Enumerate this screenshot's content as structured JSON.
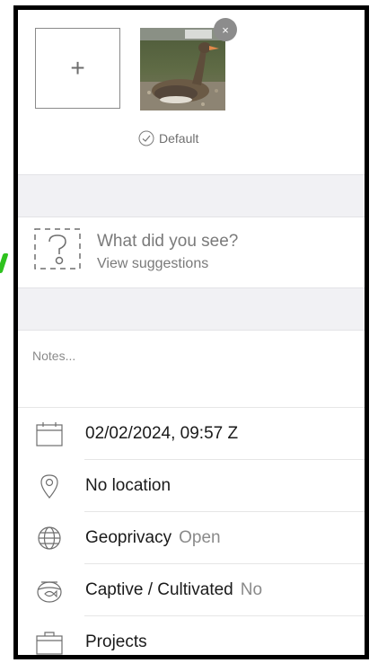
{
  "photos": {
    "add_label": "+",
    "remove_label": "×",
    "default_label": "Default"
  },
  "species": {
    "title": "What did you see?",
    "subtitle": "View suggestions"
  },
  "notes": {
    "placeholder": "Notes..."
  },
  "details": {
    "date": "02/02/2024, 09:57 Z",
    "location": "No location",
    "geoprivacy_label": "Geoprivacy",
    "geoprivacy_value": "Open",
    "captive_label": "Captive / Cultivated",
    "captive_value": "No",
    "projects_label": "Projects"
  },
  "colors": {
    "accent_green": "#2ec21e",
    "section_band": "#f1f1f4",
    "muted_text": "#7a7a7a"
  }
}
